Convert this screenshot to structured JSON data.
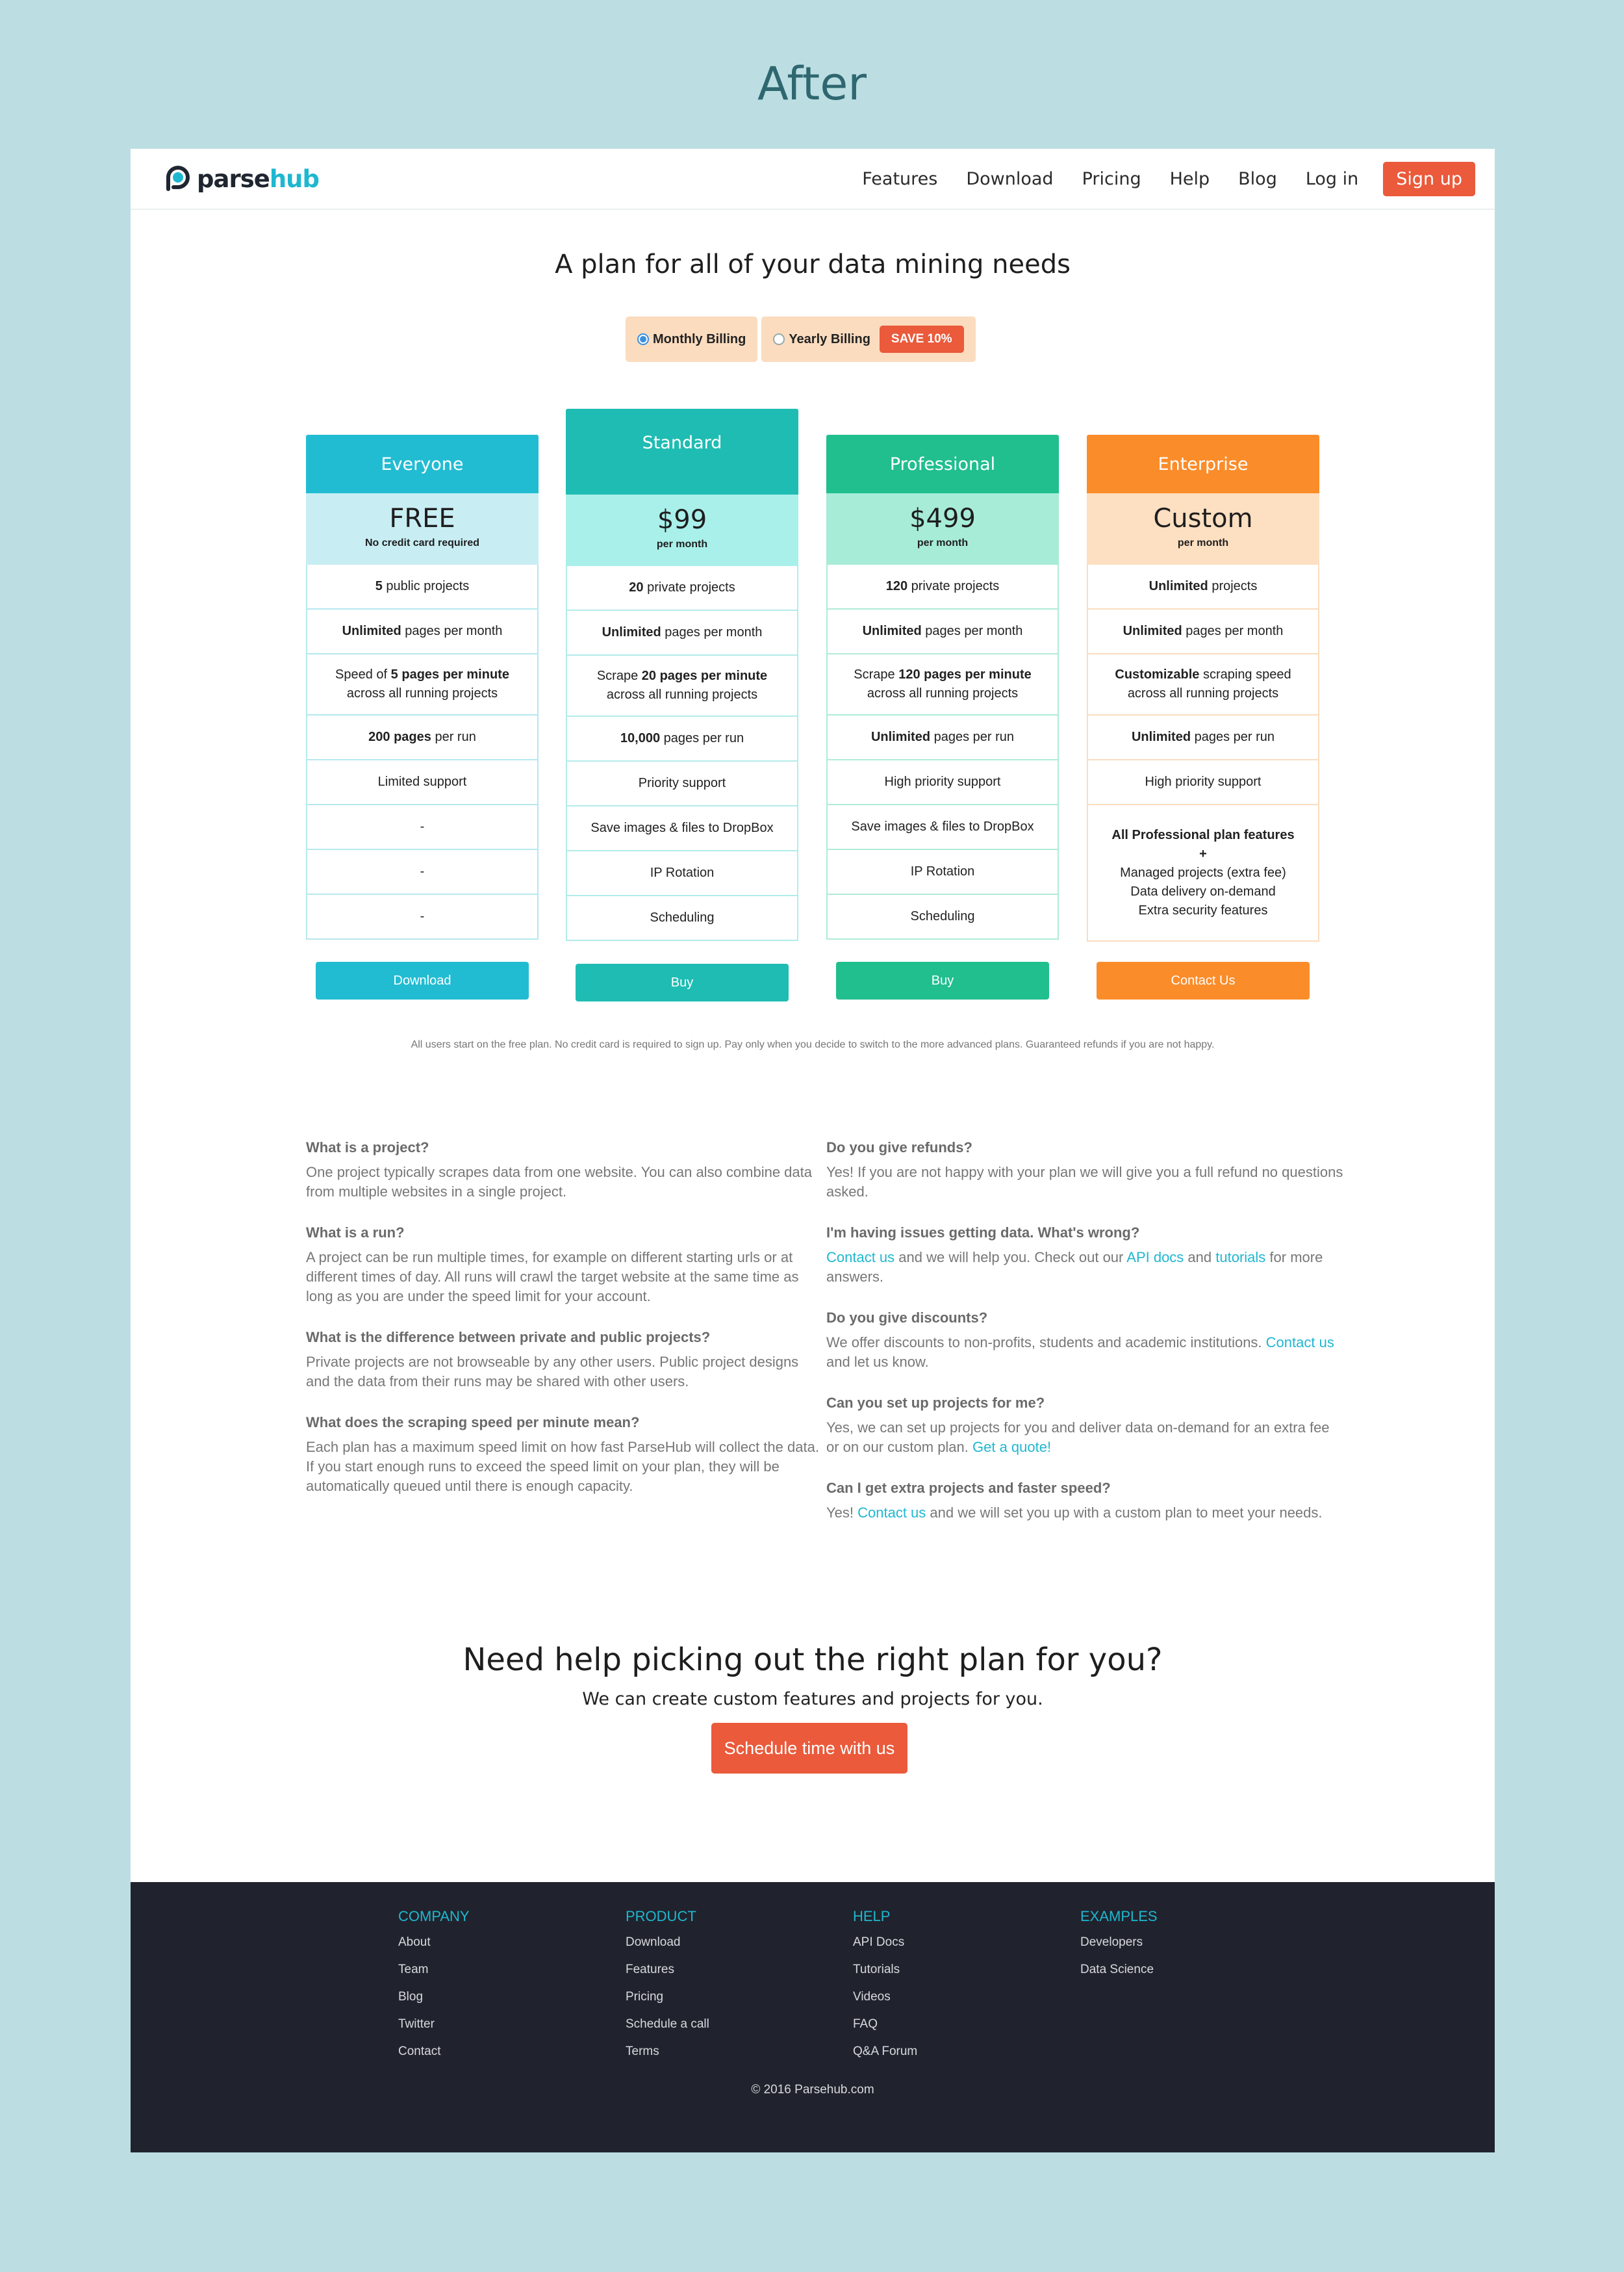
{
  "heading": "After",
  "nav": {
    "brand_part1": "parse",
    "brand_part2": "hub",
    "links": [
      "Features",
      "Download",
      "Pricing",
      "Help",
      "Blog",
      "Log in"
    ],
    "signup": "Sign up"
  },
  "page_title": "A plan for all of your data mining needs",
  "billing": {
    "monthly": "Monthly Billing",
    "yearly": "Yearly Billing",
    "save_badge": "SAVE 10%",
    "selected": "Monthly Billing"
  },
  "plans": [
    {
      "name": "Everyone",
      "price": "FREE",
      "price_sub": "No credit card required",
      "head_color": "#22bcd2",
      "price_bg": "#c8eef4",
      "border": "#b6e8ef",
      "button": "Download",
      "button_color": "#22bcd2",
      "features": [
        [
          "<b>5</b> public projects"
        ],
        [
          "<b>Unlimited</b> pages per month"
        ],
        [
          "Speed of <b>5 pages per minute</b>",
          "across all running projects"
        ],
        [
          "<b>200 pages</b> per run"
        ],
        [
          "Limited support"
        ],
        [
          "-"
        ],
        [
          "-"
        ],
        [
          "-"
        ]
      ]
    },
    {
      "name": "Standard",
      "price": "$99",
      "price_sub": "per month",
      "head_color": "#1fbcb3",
      "price_bg": "#a9f0ea",
      "border": "#b2ecea",
      "button": "Buy",
      "button_color": "#1fbcb3",
      "features": [
        [
          "<b>20</b> private projects"
        ],
        [
          "<b>Unlimited</b> pages per month"
        ],
        [
          "Scrape <b>20 pages per minute</b>",
          "across all running projects"
        ],
        [
          "<b>10,000</b> pages per run"
        ],
        [
          "Priority support"
        ],
        [
          "Save images &amp; files to DropBox"
        ],
        [
          "IP Rotation"
        ],
        [
          "Scheduling"
        ]
      ]
    },
    {
      "name": "Professional",
      "price": "$499",
      "price_sub": "per month",
      "head_color": "#20bf8d",
      "price_bg": "#a7ecd7",
      "border": "#b0ecd6",
      "button": "Buy",
      "button_color": "#20bf8d",
      "features": [
        [
          "<b>120</b> private projects"
        ],
        [
          "<b>Unlimited</b> pages per month"
        ],
        [
          "Scrape <b>120 pages per minute</b>",
          "across all running projects"
        ],
        [
          "<b>Unlimited</b> pages per run"
        ],
        [
          "High priority support"
        ],
        [
          "Save images &amp; files to DropBox"
        ],
        [
          "IP Rotation"
        ],
        [
          "Scheduling"
        ]
      ]
    },
    {
      "name": "Enterprise",
      "price": "Custom",
      "price_sub": "per month",
      "head_color": "#fb8c2a",
      "price_bg": "#fddfc1",
      "border": "#fbdcc0",
      "button": "Contact Us",
      "button_color": "#fb8c2a",
      "features": [
        [
          "<b>Unlimited</b> projects"
        ],
        [
          "<b>Unlimited</b> pages per month"
        ],
        [
          "<b>Customizable</b> scraping speed",
          "across all running projects"
        ],
        [
          "<b>Unlimited</b> pages per run"
        ],
        [
          "High priority support"
        ],
        [
          "<b>All Professional plan features</b>",
          "<b>+</b>",
          "Managed projects (extra fee)",
          "Data delivery on-demand",
          "Extra security features"
        ]
      ]
    }
  ],
  "note": "All users start on the free plan. No credit card is required to sign up. Pay only when you decide to switch to the more advanced plans. Guaranteed refunds if you are not happy.",
  "faq_left": [
    {
      "q": "What is a project?",
      "a": "One project typically scrapes data from one website. You can also combine data from multiple websites in a single project."
    },
    {
      "q": "What is a run?",
      "a": "A project can be run multiple times, for example on different starting urls or at different times of day. All runs will crawl the target website at the same time as long as you are under the speed limit for your account."
    },
    {
      "q": "What is the difference between private and public projects?",
      "a": "Private projects are not browseable by any other users. Public project designs and the data from their runs may be shared with other users."
    },
    {
      "q": "What does the scraping speed per minute mean?",
      "a": "Each plan has a maximum speed limit on how fast ParseHub will collect the data. If you start enough runs to exceed the speed limit on your plan, they will be automatically queued until there is enough capacity."
    }
  ],
  "faq_right": [
    {
      "q": "Do you give refunds?",
      "a": "Yes! If you are not happy with your plan we will give you a full refund no questions asked."
    },
    {
      "q": "I'm having issues getting data. What's wrong?",
      "a": "<span class='lnk'>Contact us</span> and we will help you. Check out our <span class='lnk'>API docs</span> and <span class='lnk'>tutorials</span> for more answers."
    },
    {
      "q": "Do you give discounts?",
      "a": "We offer discounts to non-profits, students and academic institutions. <span class='lnk'>Contact us</span> and let us know."
    },
    {
      "q": "Can you set up projects for me?",
      "a": "Yes, we can set up projects for you and deliver data on-demand for an extra fee or on our custom plan. <span class='lnk'>Get a quote!</span>"
    },
    {
      "q": "Can I get extra projects and faster speed?",
      "a": "Yes! <span class='lnk'>Contact us</span> and we will set you up with a custom plan to meet your needs."
    }
  ],
  "help": {
    "title": "Need help picking out the right plan for you?",
    "subtitle": "We can create custom features and projects for you.",
    "button": "Schedule time with us"
  },
  "footer": {
    "columns": [
      {
        "title": "COMPANY",
        "links": [
          "About",
          "Team",
          "Blog",
          "Twitter",
          "Contact"
        ]
      },
      {
        "title": "PRODUCT",
        "links": [
          "Download",
          "Features",
          "Pricing",
          "Schedule a call",
          "Terms"
        ]
      },
      {
        "title": "HELP",
        "links": [
          "API Docs",
          "Tutorials",
          "Videos",
          "FAQ",
          "Q&A Forum"
        ]
      },
      {
        "title": "EXAMPLES",
        "links": [
          "Developers",
          "Data Science"
        ]
      }
    ],
    "copyright": "© 2016 Parsehub.com"
  },
  "colors": {
    "accent": "#1fb7d0",
    "cta": "#ea5a3b",
    "footer_bg": "#20232d",
    "page_bg": "#bcdee2"
  }
}
